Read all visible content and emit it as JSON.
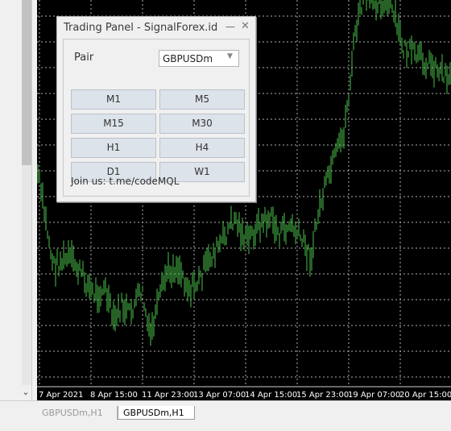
{
  "panel": {
    "title": "Trading Panel - SignalForex.id",
    "pair_label": "Pair",
    "pair_value": "GBPUSDm",
    "buttons": [
      "M1",
      "M5",
      "M15",
      "M30",
      "H1",
      "H4",
      "D1",
      "W1"
    ],
    "join_text": "Join us: t.me/codeMQL"
  },
  "chart": {
    "time_labels": [
      "7 Apr 2021",
      "8 Apr 15:00",
      "11 Apr 23:00",
      "13 Apr 07:00",
      "14 Apr 15:00",
      "15 Apr 23:00",
      "19 Apr 07:00",
      "20 Apr 15:00"
    ],
    "colors": {
      "background": "#000000",
      "grid": "#b0b0b0",
      "bars": "#4cc24c",
      "axis_text": "#ffffff"
    }
  },
  "tabs": [
    "GBPUSDm,H1",
    "GBPUSDm,H1"
  ],
  "icons": {
    "minimize": "minimize-icon",
    "close": "close-icon",
    "scroll_down": "chevron-down-icon"
  }
}
